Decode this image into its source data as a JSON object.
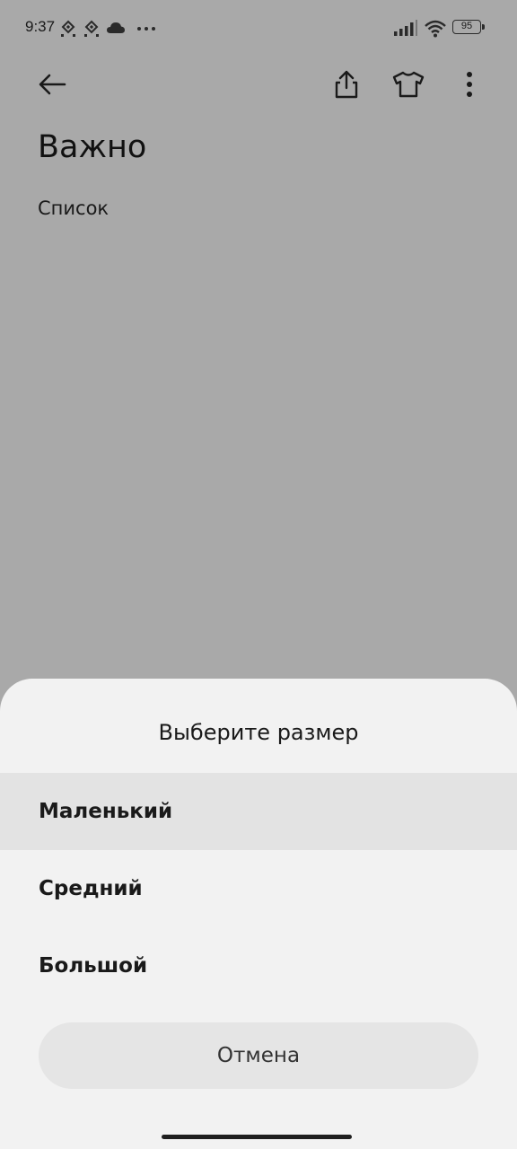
{
  "status_bar": {
    "time": "9:37",
    "icons": [
      "binance-icon",
      "binance-icon",
      "cloud-icon",
      "more-dots-icon",
      "signal-icon",
      "wifi-icon",
      "battery-icon"
    ],
    "battery_level": "95"
  },
  "app_bar": {
    "icons": [
      "back-arrow-icon",
      "share-icon",
      "tshirt-theme-icon",
      "more-vertical-icon"
    ]
  },
  "note": {
    "title": "Важно",
    "body": "Список"
  },
  "size_sheet": {
    "title": "Выберите размер",
    "options": [
      "Маленький",
      "Средний",
      "Большой"
    ],
    "selected": "Маленький",
    "cancel_label": "Отмена"
  },
  "colors": {
    "scrim": "#a9a9a9",
    "sheet_bg": "#f2f2f2",
    "selected_bg": "#e3e3e3",
    "cancel_bg": "#e5e5e5"
  }
}
